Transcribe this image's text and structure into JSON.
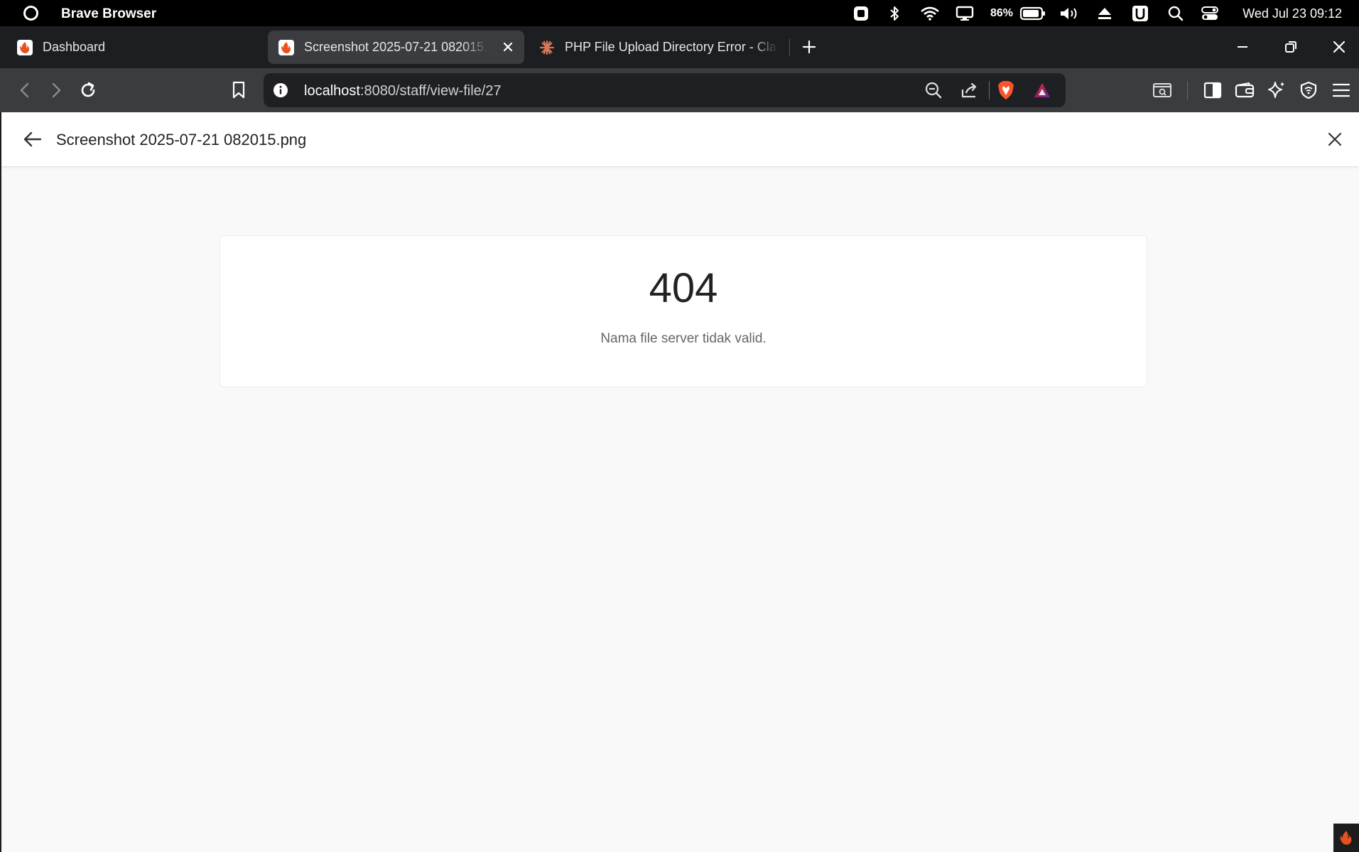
{
  "os_bar": {
    "app_name": "Brave Browser",
    "battery": "86%",
    "clock": "Wed Jul 23 09:12"
  },
  "tabs": [
    {
      "title": "Dashboard",
      "active": false
    },
    {
      "title": "Screenshot 2025-07-21 082015.png",
      "active": true
    },
    {
      "title": "PHP File Upload Directory Error - Claude",
      "active": false
    }
  ],
  "toolbar": {
    "url_host": "localhost",
    "url_path": ":8080/staff/view-file/27"
  },
  "page": {
    "title": "Screenshot 2025-07-21 082015.png",
    "error_code": "404",
    "error_message": "Nama file server tidak valid."
  },
  "colors": {
    "brand_flame": "#e8501f",
    "claude_orange": "#d97757",
    "brave_orange": "#fb542b"
  }
}
